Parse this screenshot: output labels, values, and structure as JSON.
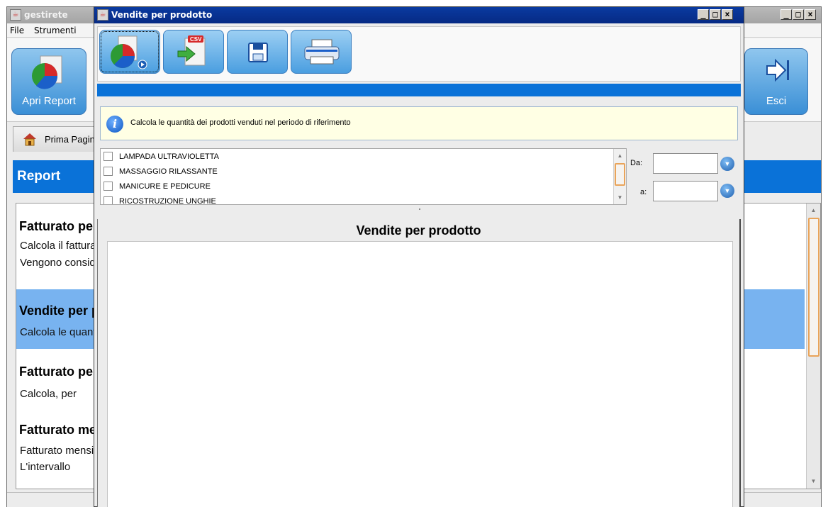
{
  "main_window": {
    "title": "gestirete",
    "menu": [
      "File",
      "Strumenti"
    ],
    "toolbar": {
      "open_report_label": "Apri Report",
      "exit_label": "Esci"
    },
    "tab_label": "Prima Pagina",
    "section_header": "Report",
    "report_list": [
      {
        "title": "Fatturato per periodo",
        "lines": [
          "Calcola il fatturato",
          "Vengono considerati"
        ],
        "selected": false
      },
      {
        "title": "Vendite per prodotto",
        "lines": [
          "Calcola le quantità"
        ],
        "selected": true
      },
      {
        "title": "Fatturato per",
        "lines": [
          "Calcola, per"
        ],
        "selected": false
      },
      {
        "title": "Fatturato mensile",
        "lines": [
          "Fatturato mensile",
          "L'intervallo"
        ],
        "selected": false
      }
    ]
  },
  "dialog": {
    "title": "Vendite per prodotto",
    "toolbar_icons": [
      "chart-icon",
      "csv-export-icon",
      "save-icon",
      "print-icon"
    ],
    "info_text": "Calcola le quantità dei prodotti venduti nel periodo di riferimento",
    "products": [
      "LAMPADA ULTRAVIOLETTA",
      "MASSAGGIO RILASSANTE",
      "MANICURE E PEDICURE",
      "RICOSTRUZIONE UNGHIE"
    ],
    "date_from_label": "Da:",
    "date_to_label": "a:",
    "date_from_value": "",
    "date_to_value": "",
    "chart_title": "Vendite per prodotto"
  },
  "colors": {
    "accent_blue": "#0a72d8",
    "selection_blue": "#78b3f0",
    "info_bg": "#ffffe4",
    "scroll_thumb": "#e9a45a"
  }
}
